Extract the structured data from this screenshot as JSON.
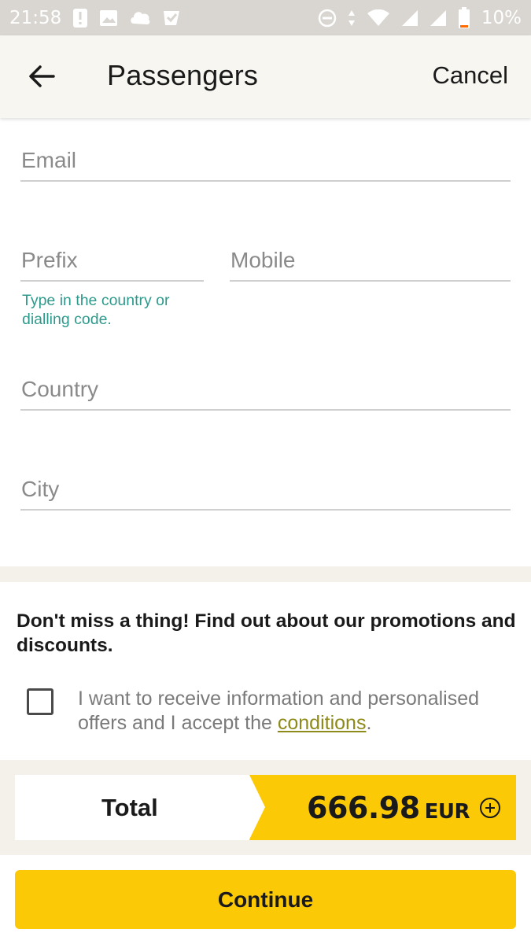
{
  "status_bar": {
    "time": "21:58",
    "battery": "10%",
    "left_icons": [
      "alert-icon",
      "image-icon",
      "cloud-app-icon",
      "check-app-icon"
    ],
    "right_icons": [
      "do-not-disturb-icon",
      "data-arrows-icon",
      "wifi-icon",
      "signal-icon",
      "signal-icon-2",
      "battery-icon"
    ]
  },
  "header": {
    "title": "Passengers",
    "cancel_label": "Cancel",
    "back_icon": "arrow-left-icon"
  },
  "form": {
    "email": {
      "value": "",
      "placeholder": "Email"
    },
    "prefix": {
      "value": "",
      "placeholder": "Prefix"
    },
    "mobile": {
      "value": "",
      "placeholder": "Mobile"
    },
    "prefix_hint": "Type in the country or dialling code.",
    "country": {
      "value": "",
      "placeholder": "Country"
    },
    "city": {
      "value": "",
      "placeholder": "City"
    }
  },
  "promotions": {
    "title": "Don't miss a thing! Find out about our promotions and discounts.",
    "consent_text_before": "I want to receive information and personalised offers and I accept the ",
    "consent_link": "conditions",
    "consent_text_after": ".",
    "checked": false
  },
  "summary": {
    "total_label": "Total",
    "amount": "666.98",
    "currency": "EUR",
    "expand_icon": "plus-circle-icon"
  },
  "footer": {
    "continue_label": "Continue"
  },
  "colors": {
    "accent": "#fcc907",
    "hint": "#2e9a8c",
    "link": "#8e8a1a",
    "status_bar": "#d9d6d1"
  }
}
